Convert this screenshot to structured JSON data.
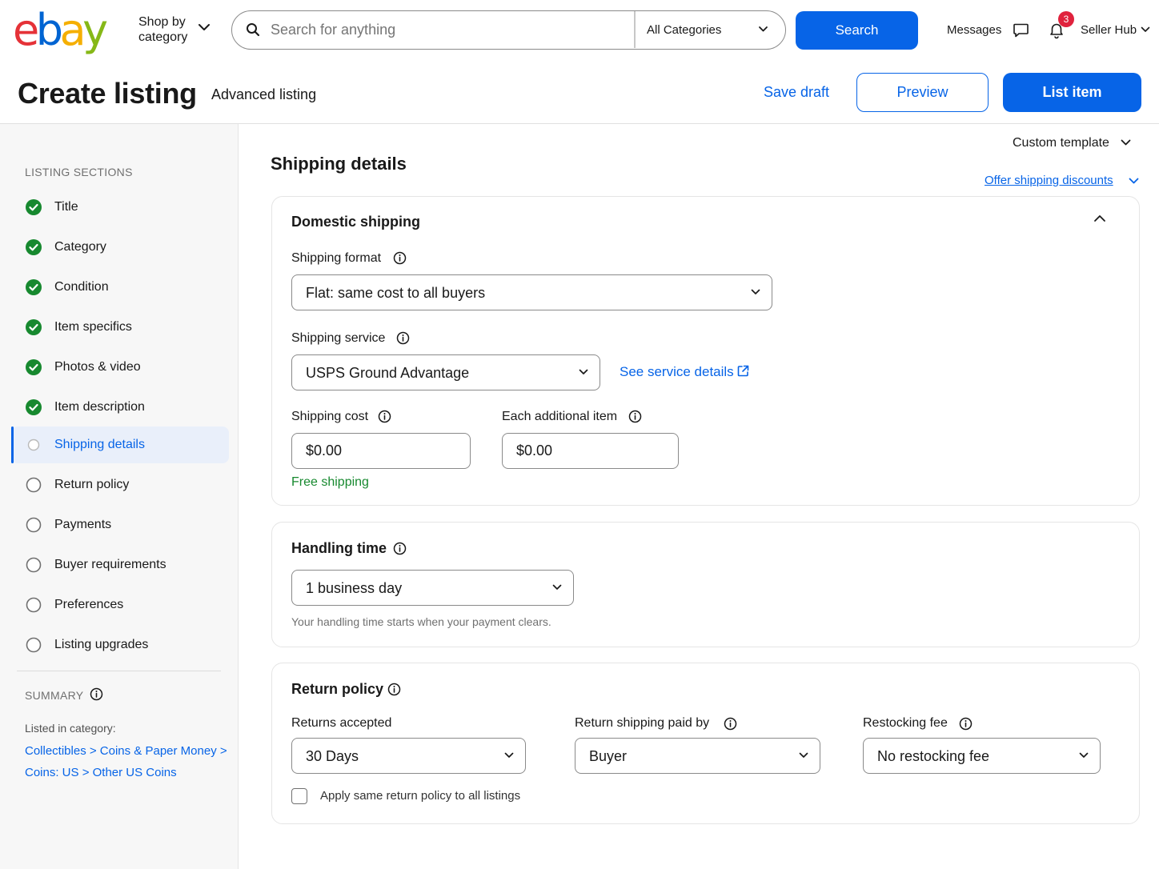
{
  "nav": {
    "logo_letters": [
      {
        "char": "e",
        "color": "#e53238"
      },
      {
        "char": "b",
        "color": "#0064d2"
      },
      {
        "char": "a",
        "color": "#f5af02"
      },
      {
        "char": "y",
        "color": "#86b817"
      }
    ],
    "shop_by_category": "Shop by category",
    "search_placeholder": "Search for anything",
    "category_select": "All Categories",
    "search_button": "Search",
    "messages": "Messages",
    "notification_count": "3",
    "seller_hub": "Seller Hub"
  },
  "header": {
    "title": "Create listing",
    "subtitle": "Advanced listing",
    "save_draft": "Save draft",
    "preview": "Preview",
    "list_item": "List item"
  },
  "sidebar": {
    "heading": "LISTING SECTIONS",
    "items": [
      {
        "label": "Title",
        "status": "complete"
      },
      {
        "label": "Category",
        "status": "complete"
      },
      {
        "label": "Condition",
        "status": "complete"
      },
      {
        "label": "Item specifics",
        "status": "complete"
      },
      {
        "label": "Photos & video",
        "status": "complete"
      },
      {
        "label": "Item description",
        "status": "complete"
      },
      {
        "label": "Shipping details",
        "status": "current"
      },
      {
        "label": "Return policy",
        "status": "incomplete"
      },
      {
        "label": "Payments",
        "status": "incomplete"
      },
      {
        "label": "Buyer requirements",
        "status": "incomplete"
      },
      {
        "label": "Preferences",
        "status": "incomplete"
      },
      {
        "label": "Listing upgrades",
        "status": "incomplete"
      }
    ],
    "summary_heading": "SUMMARY",
    "listed_in_label": "Listed in category:",
    "category_path_line1": "Collectibles > Coins & Paper Money >",
    "category_path_line2": "Coins: US > Other US Coins"
  },
  "main": {
    "custom_template": "Custom template",
    "section_title": "Shipping details",
    "offer_discounts": "Offer shipping discounts",
    "domestic": {
      "title": "Domestic shipping",
      "format_label": "Shipping format",
      "format_value": "Flat: same cost to all buyers",
      "service_label": "Shipping service",
      "service_value": "USPS Ground Advantage",
      "service_details_link": "See service details",
      "cost_label": "Shipping cost",
      "cost_value": "$0.00",
      "additional_label": "Each additional item",
      "additional_value": "$0.00",
      "free_shipping": "Free shipping"
    },
    "handling": {
      "title": "Handling time",
      "value": "1 business day",
      "hint": "Your handling time starts when your payment clears."
    },
    "returns": {
      "title": "Return policy",
      "accepted_label": "Returns accepted",
      "accepted_value": "30 Days",
      "paid_by_label": "Return shipping paid by",
      "paid_by_value": "Buyer",
      "restocking_label": "Restocking fee",
      "restocking_value": "No restocking fee",
      "apply_all": "Apply same return policy to all listings"
    }
  },
  "colors": {
    "accent": "#0764e7",
    "success": "#17892f",
    "badge": "#e0223d"
  }
}
